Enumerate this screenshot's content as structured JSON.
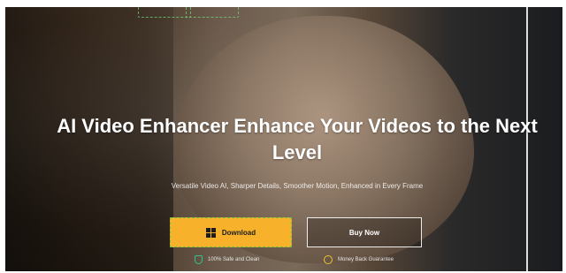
{
  "hero": {
    "title": "AI Video Enhancer Enhance Your Videos to the Next Level",
    "subtitle": "Versatile Video AI, Sharper Details, Smoother Motion, Enhanced in Every Frame"
  },
  "buttons": {
    "download_label": "Download",
    "buy_label": "Buy Now"
  },
  "trust": {
    "safe_label": "100% Safe and Clean",
    "guarantee_label": "Money Back Guarantee"
  },
  "icons": {
    "download": "windows-icon",
    "safe": "shield-icon",
    "guarantee": "coin-icon"
  },
  "colors": {
    "accent": "#f7b12a",
    "text": "#ffffff",
    "safe_icon": "#34c38f",
    "guarantee_icon": "#f2c230"
  }
}
